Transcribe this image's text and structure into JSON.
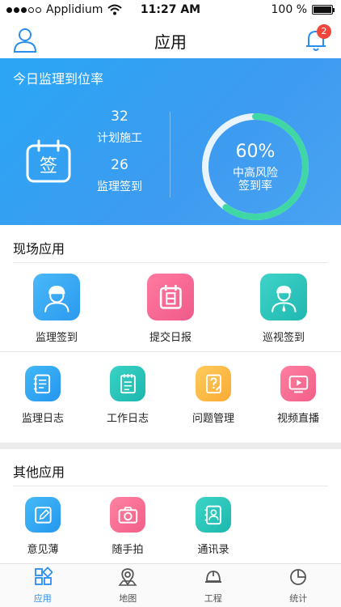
{
  "status_bar": {
    "carrier": "Applidium",
    "time": "11:27 AM",
    "battery": "100 %"
  },
  "header": {
    "title": "应用",
    "notification_count": "2"
  },
  "banner": {
    "title": "今日监理到位率",
    "planned_count": "32",
    "planned_label": "计划施工",
    "signed_count": "26",
    "signed_label": "监理签到",
    "ring_percent_text": "60%",
    "ring_percent_value": 0.6,
    "ring_label_line1": "中高风险",
    "ring_label_line2": "签到率",
    "calendar_icon_text": "签"
  },
  "site_apps": {
    "title": "现场应用",
    "row1": [
      {
        "label": "监理签到",
        "icon": "worker-helmet-icon",
        "color_from": "#4ab8f7",
        "color_to": "#2b9af0"
      },
      {
        "label": "提交日报",
        "icon": "daily-calendar-icon",
        "color_from": "#ff7aa0",
        "color_to": "#f05a8a"
      },
      {
        "label": "巡视签到",
        "icon": "inspector-icon",
        "color_from": "#3fd3c8",
        "color_to": "#1fb8b0"
      }
    ],
    "row2": [
      {
        "label": "监理日志",
        "icon": "log-icon",
        "color_from": "#41b8f6",
        "color_to": "#2596ee"
      },
      {
        "label": "工作日志",
        "icon": "notebook-icon",
        "color_from": "#3ad2c5",
        "color_to": "#1bb7ae"
      },
      {
        "label": "问题管理",
        "icon": "question-icon",
        "color_from": "#ffcb5c",
        "color_to": "#f9ab33"
      },
      {
        "label": "视频直播",
        "icon": "video-icon",
        "color_from": "#ff7fa0",
        "color_to": "#f25f88"
      }
    ]
  },
  "other_apps": {
    "title": "其他应用",
    "items": [
      {
        "label": "意见薄",
        "icon": "edit-icon",
        "color_from": "#45baf7",
        "color_to": "#2697ee"
      },
      {
        "label": "随手拍",
        "icon": "camera-icon",
        "color_from": "#ff82a2",
        "color_to": "#f25e87"
      },
      {
        "label": "通讯录",
        "icon": "contacts-icon",
        "color_from": "#3dd4c6",
        "color_to": "#1cb8ae"
      }
    ]
  },
  "tabs": [
    {
      "label": "应用",
      "icon": "apps-grid-icon",
      "active": true
    },
    {
      "label": "地图",
      "icon": "map-pin-icon",
      "active": false
    },
    {
      "label": "工程",
      "icon": "hardhat-icon",
      "active": false
    },
    {
      "label": "统计",
      "icon": "pie-chart-icon",
      "active": false
    }
  ],
  "colors": {
    "accent": "#2a8ef0",
    "banner_blue": "#2ea3f4",
    "ring_track": "#e9f2fb",
    "ring_fill": "#3fd8a4",
    "badge": "#f0463c"
  }
}
